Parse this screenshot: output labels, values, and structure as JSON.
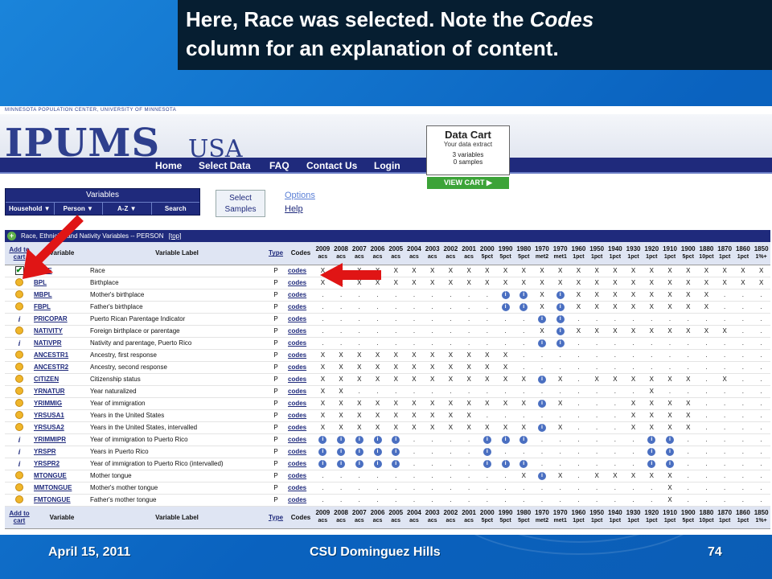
{
  "caption": {
    "line1a": "Here, Race was selected. Note the ",
    "line1b": "Codes",
    "line2": "column for an explanation of content."
  },
  "site": {
    "org": "MINNESOTA POPULATION CENTER, UNIVERSITY OF MINNESOTA",
    "brand": "IPUMS",
    "brand_suffix": "USA",
    "nav": [
      "Home",
      "Select Data",
      "FAQ",
      "Contact Us",
      "Login"
    ],
    "cart": {
      "title": "Data Cart",
      "subtitle": "Your data extract",
      "variables": "3  variables",
      "samples": "0  samples",
      "view": "VIEW CART"
    },
    "variables_title": "Variables",
    "menu": [
      "Household",
      "Person",
      "A-Z",
      "Search"
    ],
    "select_samples": "Select Samples",
    "options": "Options",
    "help": "Help",
    "section": "Race, Ethnicity, and Nativity Variables -- PERSON",
    "top": "[top]"
  },
  "table": {
    "headers": {
      "add": "Add to cart",
      "variable": "Variable",
      "label": "Variable Label",
      "type": "Type",
      "codes": "Codes"
    },
    "years": [
      [
        "2009",
        "acs"
      ],
      [
        "2008",
        "acs"
      ],
      [
        "2007",
        "acs"
      ],
      [
        "2006",
        "acs"
      ],
      [
        "2005",
        "acs"
      ],
      [
        "2004",
        "acs"
      ],
      [
        "2003",
        "acs"
      ],
      [
        "2002",
        "acs"
      ],
      [
        "2001",
        "acs"
      ],
      [
        "2000",
        "5pct"
      ],
      [
        "1990",
        "5pct"
      ],
      [
        "1980",
        "5pct"
      ],
      [
        "1970",
        "met2"
      ],
      [
        "1970",
        "met1"
      ],
      [
        "1960",
        "1pct"
      ],
      [
        "1950",
        "1pct"
      ],
      [
        "1940",
        "1pct"
      ],
      [
        "1930",
        "1pct"
      ],
      [
        "1920",
        "1pct"
      ],
      [
        "1910",
        "1pct"
      ],
      [
        "1900",
        "5pct"
      ],
      [
        "1880",
        "10pct"
      ],
      [
        "1870",
        "1pct"
      ],
      [
        "1860",
        "1pct"
      ],
      [
        "1850",
        "1%+"
      ]
    ],
    "rows": [
      {
        "icon": "check",
        "name": "RACE",
        "label": "Race",
        "type": "P",
        "codes": "codes",
        "cells": "XXXXXXXXXXXXXXXXXXXXXXXXX"
      },
      {
        "icon": "add",
        "name": "BPL",
        "label": "Birthplace",
        "type": "P",
        "codes": "codes",
        "cells": "XXXXXXXXXXXXXXXXXXXXXXXXX"
      },
      {
        "icon": "add",
        "name": "MBPL",
        "label": "Mother's birthplace",
        "type": "P",
        "codes": "codes",
        "cells": "..........iiXiXXXXXXXX..."
      },
      {
        "icon": "add",
        "name": "FBPL",
        "label": "Father's birthplace",
        "type": "P",
        "codes": "codes",
        "cells": "..........iiXiXXXXXXXX..."
      },
      {
        "icon": "ital",
        "name": "PRICOPAR",
        "label": "Puerto Rican Parentage Indicator",
        "type": "P",
        "codes": "codes",
        "cells": "............ii..........."
      },
      {
        "icon": "add",
        "name": "NATIVITY",
        "label": "Foreign birthplace or parentage",
        "type": "P",
        "codes": "codes",
        "cells": "............XiXXXXXXXXX.."
      },
      {
        "icon": "ital",
        "name": "NATIVPR",
        "label": "Nativity and parentage, Puerto Rico",
        "type": "P",
        "codes": "codes",
        "cells": "............ii..........."
      },
      {
        "icon": "add",
        "name": "ANCESTR1",
        "label": "Ancestry, first response",
        "type": "P",
        "codes": "codes",
        "cells": "XXXXXXXXXXX.............."
      },
      {
        "icon": "add",
        "name": "ANCESTR2",
        "label": "Ancestry, second response",
        "type": "P",
        "codes": "codes",
        "cells": "XXXXXXXXXXX.............."
      },
      {
        "icon": "add",
        "name": "CITIZEN",
        "label": "Citizenship status",
        "type": "P",
        "codes": "codes",
        "cells": "XXXXXXXXXXXXiX.XXXXXX.X.."
      },
      {
        "icon": "add",
        "name": "YRNATUR",
        "label": "Year naturalized",
        "type": "P",
        "codes": "codes",
        "cells": "XX................X......"
      },
      {
        "icon": "add",
        "name": "YRIMMIG",
        "label": "Year of immigration",
        "type": "P",
        "codes": "codes",
        "cells": "XXXXXXXXXXXXiX...XXXX...."
      },
      {
        "icon": "add",
        "name": "YRSUSA1",
        "label": "Years in the United States",
        "type": "P",
        "codes": "codes",
        "cells": "XXXXXXXXX........XXXX...."
      },
      {
        "icon": "add",
        "name": "YRSUSA2",
        "label": "Years in the United States, intervalled",
        "type": "P",
        "codes": "codes",
        "cells": "XXXXXXXXXXXXiX...XXXX...."
      },
      {
        "icon": "ital",
        "name": "YRIMMIPR",
        "label": "Year of immigration to Puerto Rico",
        "type": "P",
        "codes": "codes",
        "cells": "iiiii....iii......ii....."
      },
      {
        "icon": "ital",
        "name": "YRSPR",
        "label": "Years in Puerto Rico",
        "type": "P",
        "codes": "codes",
        "cells": "iiiii....i........ii....."
      },
      {
        "icon": "ital",
        "name": "YRSPR2",
        "label": "Year of immigration to Puerto Rico (intervalled)",
        "type": "P",
        "codes": "codes",
        "cells": "iiiii....iii......ii....."
      },
      {
        "icon": "add",
        "name": "MTONGUE",
        "label": "Mother tongue",
        "type": "P",
        "codes": "codes",
        "cells": "...........XiX.XXXXX....."
      },
      {
        "icon": "add",
        "name": "MMTONGUE",
        "label": "Mother's mother tongue",
        "type": "P",
        "codes": "codes",
        "cells": "...................X....."
      },
      {
        "icon": "add",
        "name": "FMTONGUE",
        "label": "Father's mother tongue",
        "type": "P",
        "codes": "codes",
        "cells": "...................X....."
      }
    ]
  },
  "footer": {
    "date": "April 15, 2011",
    "center": "CSU Dominguez Hills",
    "page": "74"
  }
}
